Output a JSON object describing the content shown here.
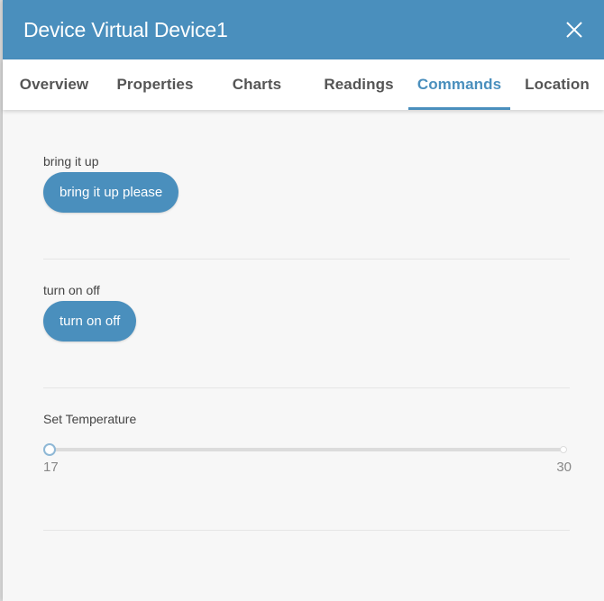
{
  "header": {
    "title": "Device Virtual Device1",
    "close_icon": "close-icon"
  },
  "tabs": [
    {
      "label": "Overview",
      "active": false
    },
    {
      "label": "Properties",
      "active": false
    },
    {
      "label": "Charts",
      "active": false
    },
    {
      "label": "Readings",
      "active": false
    },
    {
      "label": "Commands",
      "active": true
    },
    {
      "label": "Location",
      "active": false
    }
  ],
  "commands": [
    {
      "label": "bring it up",
      "button_label": "bring it up please"
    },
    {
      "label": "turn on off",
      "button_label": "turn on off"
    },
    {
      "label": "Set Temperature",
      "slider": {
        "min": "17",
        "max": "30",
        "value": 17
      }
    }
  ],
  "colors": {
    "accent": "#4a8fbd",
    "background": "#f7f7f7"
  }
}
